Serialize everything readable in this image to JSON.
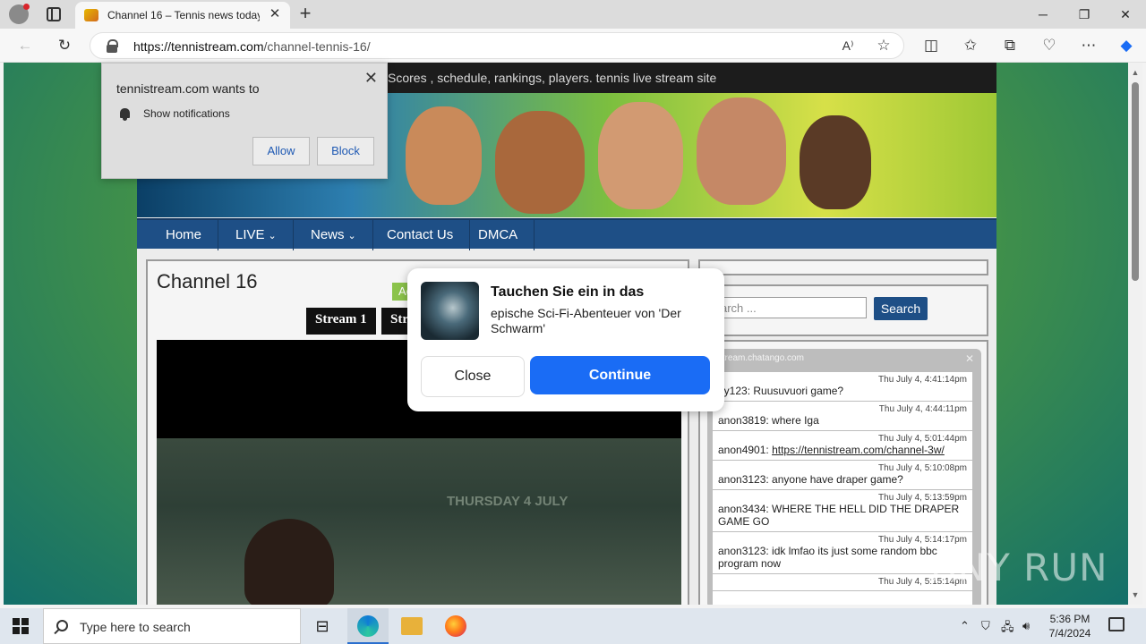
{
  "browser": {
    "tab_title": "Channel 16 – Tennis news today,",
    "url_domain": "https://tennistream.com",
    "url_path": "/channel-tennis-16/"
  },
  "site": {
    "tagline": "Scores , schedule, rankings, players. tennis live stream site",
    "nav": [
      "Home",
      "LIVE",
      "News",
      "Contact Us",
      "DMCA"
    ],
    "page_title": "Channel 16",
    "streams": [
      "Stream 1",
      "Str"
    ],
    "video_banner": "THURSDAY 4 JULY",
    "search_placeholder": "arch ...",
    "search_button": "Search"
  },
  "chat": {
    "header": "nistream.chatango.com",
    "messages": [
      {
        "time": "Thu July 4, 4:41:14pm",
        "text": "uy123: Ruusuvuori game?"
      },
      {
        "time": "Thu July 4, 4:44:11pm",
        "text": "anon3819: where Iga"
      },
      {
        "time": "Thu July 4, 5:01:44pm",
        "text": "anon4901: ",
        "link": "https://tennistream.com/channel-3w/"
      },
      {
        "time": "Thu July 4, 5:10:08pm",
        "text": "anon3123: anyone have draper game?"
      },
      {
        "time": "Thu July 4, 5:13:59pm",
        "text": "anon3434: WHERE THE HELL DID THE DRAPER GAME GO"
      },
      {
        "time": "Thu July 4, 5:14:17pm",
        "text": "anon3123: idk lmfao its just some random bbc program now"
      },
      {
        "time": "Thu July 4, 5:15:14pm",
        "text": ""
      }
    ]
  },
  "notification_prompt": {
    "title": "tennistream.com wants to",
    "permission": "Show notifications",
    "allow": "Allow",
    "block": "Block"
  },
  "ad": {
    "tag": "Ad",
    "title": "Tauchen Sie ein in das",
    "description": "epische Sci-Fi-Abenteuer von 'Der Schwarm'",
    "close": "Close",
    "continue": "Continue"
  },
  "watermark": "ANY RUN",
  "taskbar": {
    "search_placeholder": "Type here to search",
    "time": "5:36 PM",
    "date": "7/4/2024"
  },
  "colors": {
    "nav_blue": "#1e4f86",
    "continue_blue": "#1a6cf5",
    "ad_tag_green": "#8bc34a"
  }
}
